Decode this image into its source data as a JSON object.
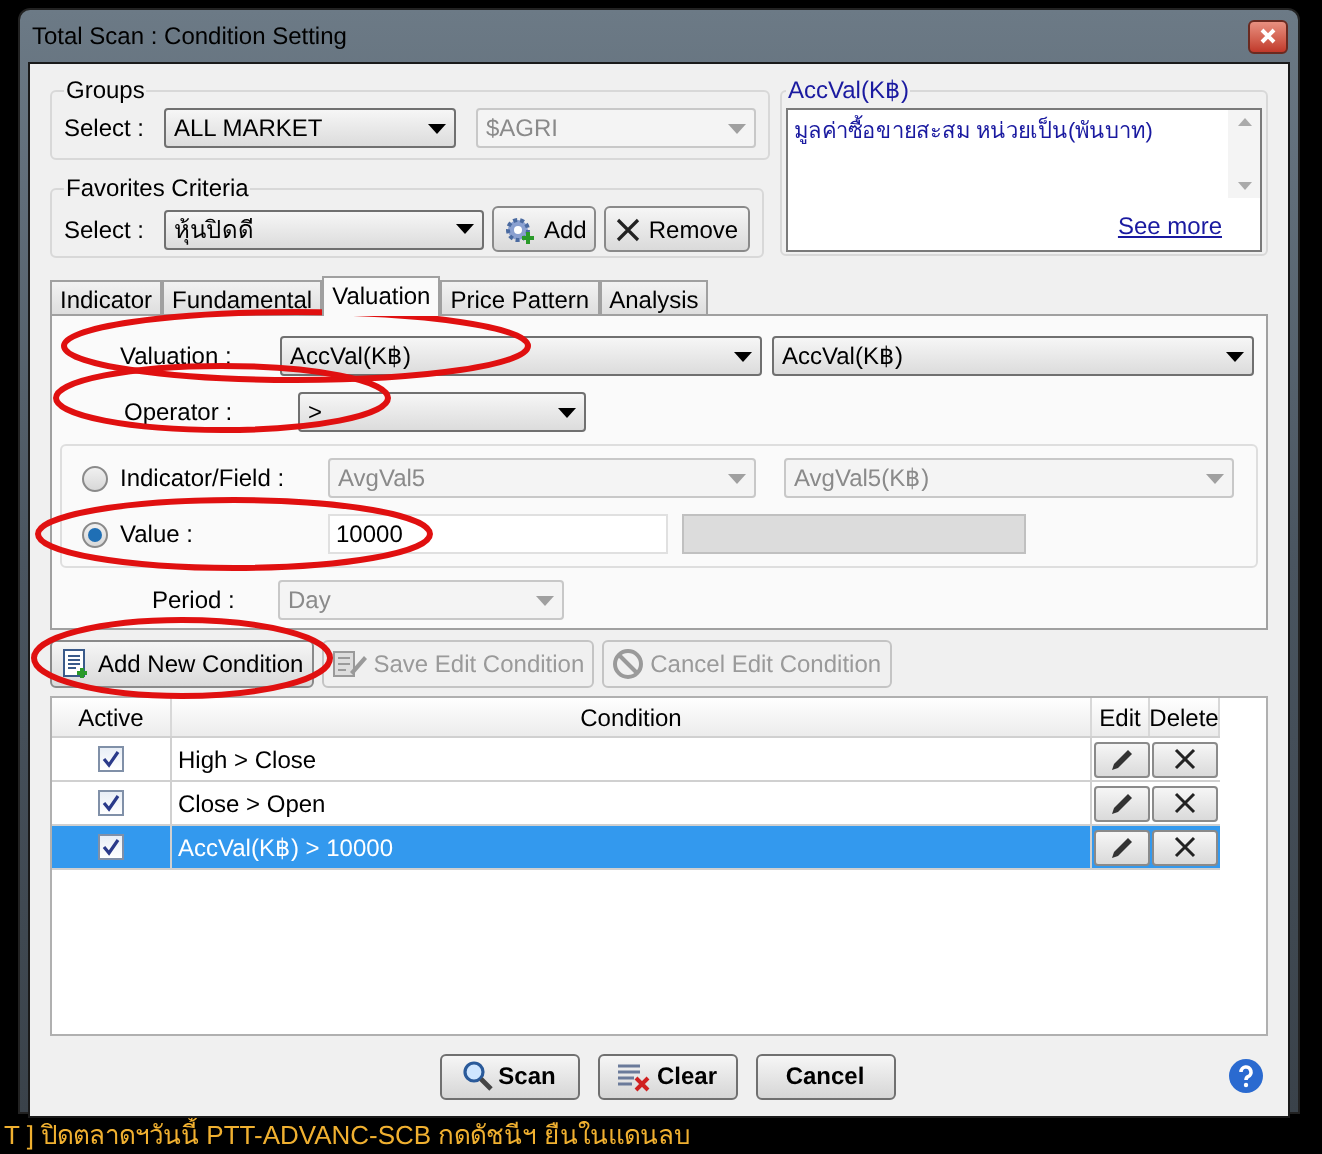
{
  "window": {
    "title": "Total Scan : Condition Setting"
  },
  "groups": {
    "title": "Groups",
    "select_label": "Select :",
    "value": "ALL MARKET",
    "sub_value": "$AGRI"
  },
  "favorites": {
    "title": "Favorites Criteria",
    "select_label": "Select :",
    "value": "หุ้นปิดดี",
    "add": "Add",
    "remove": "Remove"
  },
  "description": {
    "title": "AccVal(K฿)",
    "text": "มูลค่าซื้อขายสะสม หน่วยเป็น(พันบาท)",
    "link": "See more"
  },
  "tabs": [
    {
      "label": "Indicator",
      "selected": false
    },
    {
      "label": "Fundamental",
      "selected": false
    },
    {
      "label": "Valuation",
      "selected": true
    },
    {
      "label": "Price Pattern",
      "selected": false
    },
    {
      "label": "Analysis",
      "selected": false
    }
  ],
  "valuation": {
    "label": "Valuation :",
    "value": "AccVal(K฿)",
    "unit_value": "AccVal(K฿)"
  },
  "operator": {
    "label": "Operator :",
    "value": ">"
  },
  "indicator_field": {
    "label": "Indicator/Field :",
    "selected": false,
    "value": "AvgVal5",
    "unit_value": "AvgVal5(K฿)"
  },
  "value_option": {
    "label": "Value :",
    "selected": true,
    "value": "10000"
  },
  "period": {
    "label": "Period :",
    "value": "Day"
  },
  "actions": [
    {
      "kind": "add",
      "label": "Add New Condition",
      "disabled": false
    },
    {
      "kind": "save",
      "label": "Save Edit Condition",
      "disabled": true
    },
    {
      "kind": "cancel",
      "label": "Cancel Edit Condition",
      "disabled": true
    }
  ],
  "table": {
    "columns": [
      "Active",
      "Condition",
      "Edit",
      "Delete"
    ],
    "rows": [
      {
        "active": true,
        "condition": "High > Close",
        "selected": false
      },
      {
        "active": true,
        "condition": "Close > Open",
        "selected": false
      },
      {
        "active": true,
        "condition": "AccVal(K฿) > 10000",
        "selected": true
      }
    ]
  },
  "footer": [
    {
      "kind": "scan",
      "label": "Scan"
    },
    {
      "kind": "clear",
      "label": "Clear"
    },
    {
      "kind": "cancel",
      "label": "Cancel"
    }
  ],
  "ticker": "T ]  ปิดตลาดฯวันนี้ PTT-ADVANC-SCB กดดัชนีฯ ยืนในแดนลบ"
}
